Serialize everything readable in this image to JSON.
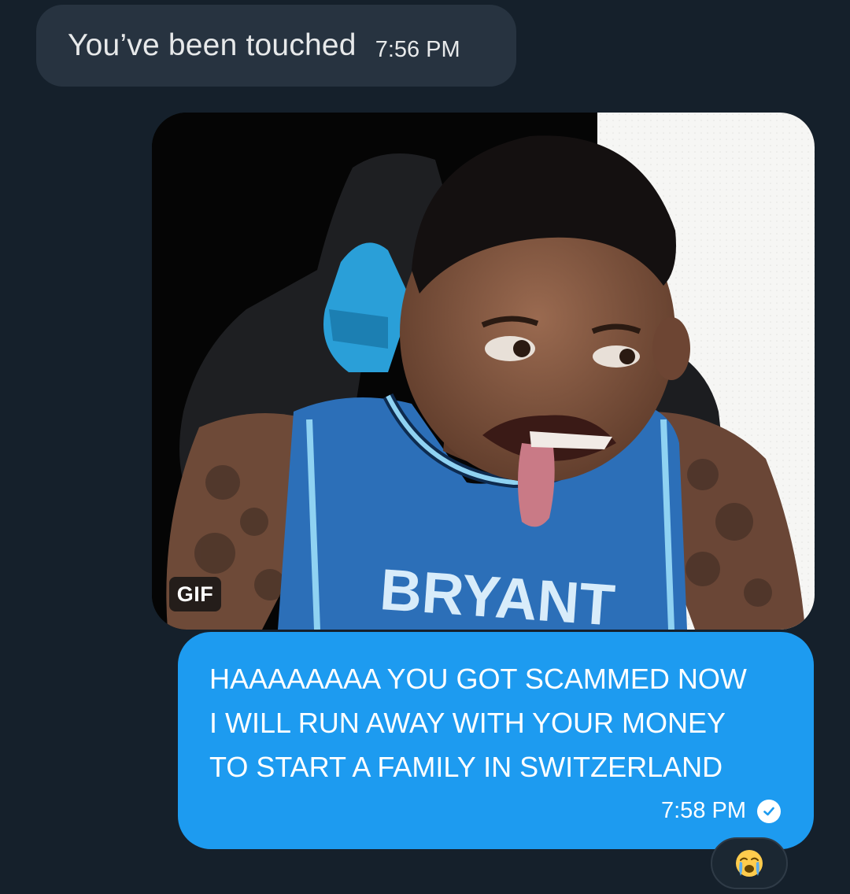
{
  "incoming_message": {
    "text": "You’ve been touched",
    "time": "7:56 PM"
  },
  "gif_attachment": {
    "badge": "GIF",
    "jersey_text": "BRYANT"
  },
  "outgoing_message": {
    "text": "HAAAAAAAA YOU GOT SCAMMED NOW I WILL RUN AWAY WITH YOUR MONEY TO START A FAMILY IN SWITZERLAND",
    "time": "7:58 PM",
    "status": "sent-check-icon"
  },
  "reaction": {
    "emoji": "crying-face-icon"
  },
  "colors": {
    "background": "#15202b",
    "incoming_bubble": "#273340",
    "outgoing_bubble": "#1d9bf0"
  }
}
